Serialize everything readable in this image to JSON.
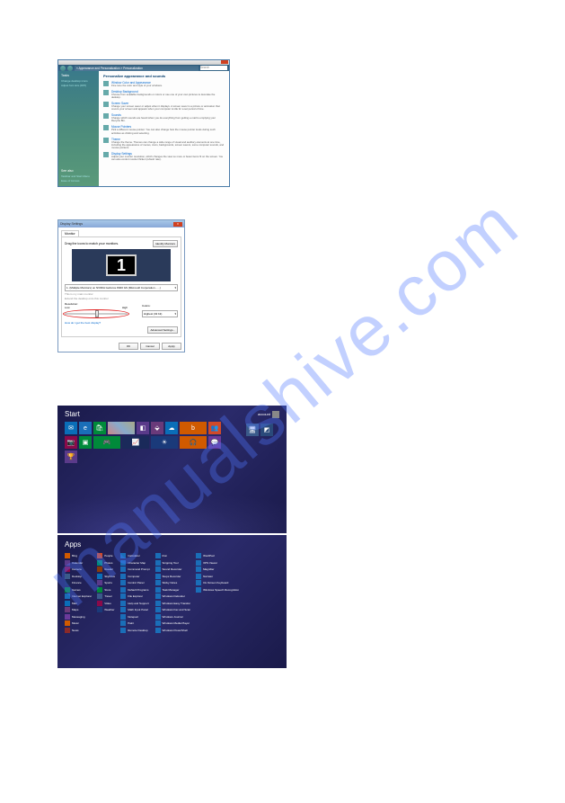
{
  "watermark": "manualshive.com",
  "personalization": {
    "breadcrumb": "« Appearance and Personalization » Personalization",
    "search_placeholder": "Search",
    "sidebar": {
      "tasks_heading": "Tasks",
      "tasks": [
        "Change desktop icons",
        "Adjust font size (DPI)"
      ],
      "see_also": "See also",
      "see_also_items": [
        "Taskbar and Start Menu",
        "Ease of Access"
      ]
    },
    "main": {
      "heading": "Personalize appearance and sounds",
      "items": [
        {
          "title": "Window Color and Appearance",
          "desc": "Fine tune the color and style of your windows."
        },
        {
          "title": "Desktop Background",
          "desc": "Choose from available backgrounds or colors or use one of your own pictures to decorate the desktop."
        },
        {
          "title": "Screen Saver",
          "desc": "Change your screen saver or adjust when it displays. A screen saver is a picture or animation that covers your screen and appears when your computer is idle for a set period of time."
        },
        {
          "title": "Sounds",
          "desc": "Change which sounds are heard when you do everything from getting e-mail to emptying your Recycle Bin."
        },
        {
          "title": "Mouse Pointers",
          "desc": "Pick a different mouse pointer. You can also change how the mouse pointer looks during such activities as clicking and selecting."
        },
        {
          "title": "Theme",
          "desc": "Change the theme. Themes can change a wide range of visual and auditory elements at one time, including the appearance of menus, icons, backgrounds, screen savers, some computer sounds, and mouse pointers."
        },
        {
          "title": "Display Settings",
          "desc": "Adjust your monitor resolution, which changes the view so more or fewer items fit on the screen. You can also control monitor flicker (refresh rate)."
        }
      ]
    }
  },
  "display_settings": {
    "title": "Display Settings",
    "close": "X",
    "tab": "Monitor",
    "instruction": "Drag the icons to match your monitors.",
    "identify_btn": "Identify Monitors",
    "monitor_num": "1",
    "dropdown": "1. (Multiple Monitors) on NVIDIA GeForce 8400 GS (Microsoft Corporation - ...)",
    "check1": "This is my main monitor",
    "check2": "Extend the desktop onto this monitor",
    "resolution_label": "Resolution:",
    "res_low": "Low",
    "res_high": "High",
    "colors_label": "Colors:",
    "colors_value": "Highest (32 bit)",
    "link": "How do I get the best display?",
    "advanced_btn": "Advanced Settings...",
    "ok": "OK",
    "cancel": "Cancel",
    "apply": "Apply"
  },
  "start_screen": {
    "title": "Start",
    "username": "account",
    "tiles": [
      {
        "name": "mail",
        "color": "#0a6eb8",
        "glyph": "✉"
      },
      {
        "name": "ie",
        "color": "#1a6eb8",
        "glyph": "e"
      },
      {
        "name": "store",
        "color": "#008a3a",
        "glyph": "🛍"
      },
      {
        "name": "photo",
        "color": "#8a4a2a",
        "glyph": "",
        "wide": true,
        "img": true
      },
      {
        "name": "tile-a",
        "color": "#5a3a8a",
        "glyph": "◧"
      },
      {
        "name": "maps",
        "color": "#6a3a7a",
        "glyph": "⬙"
      },
      {
        "name": "skydrive",
        "color": "#0a6eb8",
        "glyph": "☁"
      },
      {
        "name": "bing",
        "color": "#d05a00",
        "glyph": "b",
        "wide": true
      },
      {
        "name": "people",
        "color": "#d04a2a",
        "glyph": "👥"
      },
      {
        "name": "camera",
        "color": "#8a0a4a",
        "glyph": "📷"
      },
      {
        "name": "tile-b",
        "color": "#008a3a",
        "glyph": "▣"
      },
      {
        "name": "games",
        "color": "#008a3a",
        "glyph": "🎮",
        "wide": true
      },
      {
        "name": "finance",
        "color": "#1a2a5a",
        "glyph": "📈",
        "wide": true
      },
      {
        "name": "weather",
        "color": "#1a3a7a",
        "glyph": "☀",
        "wide": true
      },
      {
        "name": "music",
        "color": "#d05a00",
        "glyph": "🎧",
        "wide": true
      },
      {
        "name": "messaging",
        "color": "#6a3a9a",
        "glyph": "💬"
      },
      {
        "name": "sports",
        "color": "#5a3a8a",
        "glyph": "🏆"
      }
    ],
    "extra_tiles": [
      {
        "name": "desktop",
        "color": "#3a5a8a",
        "glyph": "🖥"
      },
      {
        "name": "extra1",
        "color": "#2a4a7a",
        "glyph": "◩"
      }
    ]
  },
  "apps_screen": {
    "title": "Apps",
    "columns": [
      [
        {
          "name": "Bing",
          "color": "#d05a00"
        },
        {
          "name": "Calendar",
          "color": "#5a3a8a"
        },
        {
          "name": "Camera",
          "color": "#8a0a4a"
        },
        {
          "name": "Desktop",
          "color": "#3a5a8a"
        },
        {
          "name": "Finance",
          "color": "#1a2a5a"
        },
        {
          "name": "Games",
          "color": "#008a3a"
        },
        {
          "name": "Internet Explorer",
          "color": "#1a6eb8"
        },
        {
          "name": "Mail",
          "color": "#0a6eb8"
        },
        {
          "name": "Maps",
          "color": "#6a3a7a"
        },
        {
          "name": "Messaging",
          "color": "#6a3a9a"
        },
        {
          "name": "Music",
          "color": "#d05a00"
        },
        {
          "name": "News",
          "color": "#8a2a2a"
        }
      ],
      [
        {
          "name": "People",
          "color": "#d04a2a"
        },
        {
          "name": "Photos",
          "color": "#008a7a"
        },
        {
          "name": "Reader",
          "color": "#8a3a0a"
        },
        {
          "name": "SkyDrive",
          "color": "#0a6eb8"
        },
        {
          "name": "Sports",
          "color": "#5a3a8a"
        },
        {
          "name": "Store",
          "color": "#008a3a"
        },
        {
          "name": "Travel",
          "color": "#3a5a8a"
        },
        {
          "name": "Video",
          "color": "#8a0a4a"
        },
        {
          "name": "Weather",
          "color": "#1a3a7a"
        }
      ],
      [
        {
          "name": "Calculator",
          "color": "#1a6eb8"
        },
        {
          "name": "Character Map",
          "color": "#1a6eb8"
        },
        {
          "name": "Command Prompt",
          "color": "#1a6eb8"
        },
        {
          "name": "Computer",
          "color": "#1a6eb8"
        },
        {
          "name": "Control Panel",
          "color": "#1a6eb8"
        },
        {
          "name": "Default Programs",
          "color": "#1a6eb8"
        },
        {
          "name": "File Explorer",
          "color": "#1a6eb8"
        },
        {
          "name": "Help and Support",
          "color": "#1a6eb8"
        },
        {
          "name": "Math Input Panel",
          "color": "#1a6eb8"
        },
        {
          "name": "Notepad",
          "color": "#1a6eb8"
        },
        {
          "name": "Paint",
          "color": "#1a6eb8"
        },
        {
          "name": "Remote Desktop",
          "color": "#1a6eb8"
        }
      ],
      [
        {
          "name": "Run",
          "color": "#1a6eb8"
        },
        {
          "name": "Snipping Tool",
          "color": "#1a6eb8"
        },
        {
          "name": "Sound Recorder",
          "color": "#1a6eb8"
        },
        {
          "name": "Steps Recorder",
          "color": "#1a6eb8"
        },
        {
          "name": "Sticky Notes",
          "color": "#1a6eb8"
        },
        {
          "name": "Task Manager",
          "color": "#1a6eb8"
        },
        {
          "name": "Windows Defender",
          "color": "#1a6eb8"
        },
        {
          "name": "Windows Easy Transfer",
          "color": "#1a6eb8"
        },
        {
          "name": "Windows Fax and Scan",
          "color": "#1a6eb8"
        },
        {
          "name": "Windows Journal",
          "color": "#1a6eb8"
        },
        {
          "name": "Windows Media Player",
          "color": "#1a6eb8"
        },
        {
          "name": "Windows PowerShell",
          "color": "#1a6eb8"
        }
      ],
      [
        {
          "name": "WordPad",
          "color": "#1a6eb8"
        },
        {
          "name": "XPS Viewer",
          "color": "#1a6eb8"
        },
        {
          "name": "Magnifier",
          "color": "#1a6eb8"
        },
        {
          "name": "Narrator",
          "color": "#1a6eb8"
        },
        {
          "name": "On-Screen Keyboard",
          "color": "#1a6eb8"
        },
        {
          "name": "Windows Speech Recognition",
          "color": "#1a6eb8"
        }
      ]
    ]
  }
}
